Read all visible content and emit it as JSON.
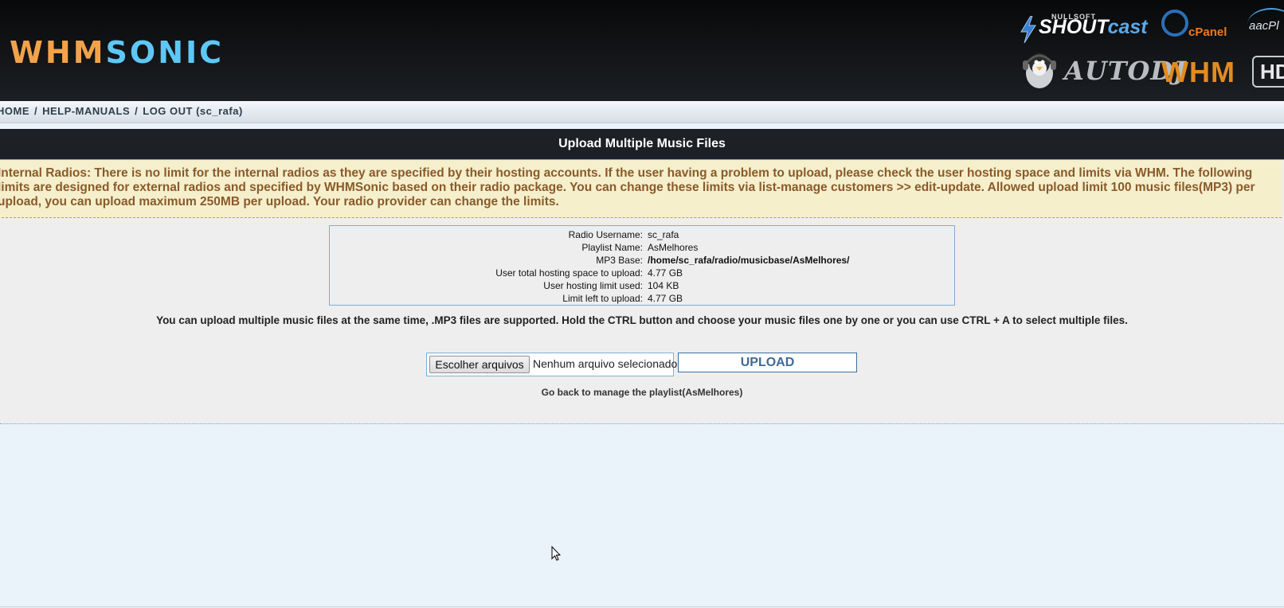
{
  "header": {
    "logo_left": "WHM",
    "logo_right": "SONIC",
    "brands": {
      "shoutcast_prefix": "NULLSOFT",
      "shoutcast_main": "SHOUT",
      "shoutcast_suffix": "cast",
      "cpanel": "cPanel",
      "aac": "aacPl",
      "autodj": "AUTODJ",
      "whm": "WHM",
      "hd": "HD"
    }
  },
  "breadcrumb": {
    "home": "HOME",
    "help": "HELP-MANUALS",
    "logout": "LOG OUT (sc_rafa)",
    "separator": "/"
  },
  "page": {
    "title": "Upload Multiple Music Files",
    "notice": "Internal Radios: There is no limit for the internal radios as they are specified by their hosting accounts. If the user having a problem to upload, please check the user hosting space and limits via WHM. The following limits are designed for external radios and specified by WHMSonic based on their radio package. You can change these limits via list-manage customers >> edit-update. Allowed upload limit 100 music files(MP3) per upload, you can upload maximum 250MB per upload. Your radio provider can change the limits.",
    "info": [
      {
        "label": "Radio Username:",
        "value": "sc_rafa"
      },
      {
        "label": "Playlist Name:",
        "value": "AsMelhores"
      },
      {
        "label": "MP3 Base:",
        "value": "/home/sc_rafa/radio/musicbase/AsMelhores/"
      },
      {
        "label": "User total hosting space to upload:",
        "value": "4.77 GB"
      },
      {
        "label": "User hosting limit used:",
        "value": "104 KB"
      },
      {
        "label": "Limit left to upload:",
        "value": "4.77 GB"
      }
    ],
    "instructions": "You can upload multiple music files at the same time, .MP3 files are supported. Hold the CTRL button and choose your music files one by one or you can use CTRL + A to select multiple files.",
    "file_button": "Escolher arquivos",
    "file_status": "Nenhum arquivo selecionado",
    "upload_button": "UPLOAD",
    "back_link": "Go back to manage the playlist(AsMelhores)"
  },
  "colors": {
    "header_bg": "#111316",
    "logo_orange": "#f2a24a",
    "logo_blue": "#5ec8f4",
    "notice_bg": "#f5efcc",
    "notice_text": "#8a5a2a",
    "upload_text": "#3f6a96"
  }
}
